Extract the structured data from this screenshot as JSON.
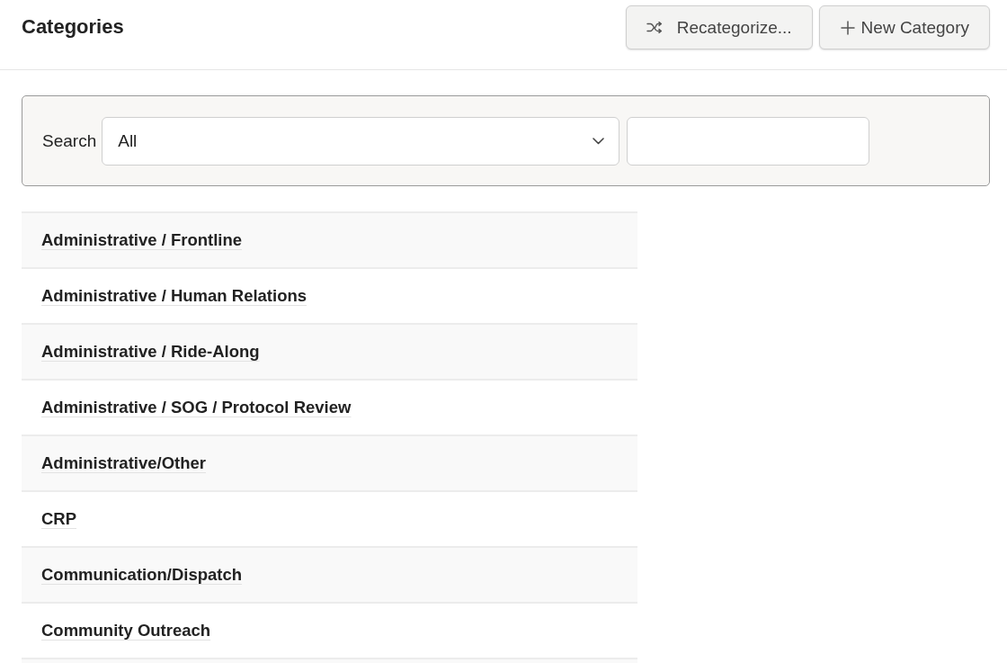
{
  "header": {
    "title": "Categories",
    "buttons": [
      {
        "kind": "shuffle",
        "label": "Recategorize..."
      },
      {
        "kind": "add",
        "label": "New Category"
      }
    ]
  },
  "search": {
    "label": "Search",
    "select": {
      "value": "All"
    }
  },
  "categories": [
    "Administrative / Frontline",
    "Administrative / Human Relations",
    "Administrative / Ride-Along",
    "Administrative / SOG / Protocol Review",
    "Administrative/Other",
    "CRP",
    "Communication/Dispatch",
    "Community Outreach"
  ]
}
